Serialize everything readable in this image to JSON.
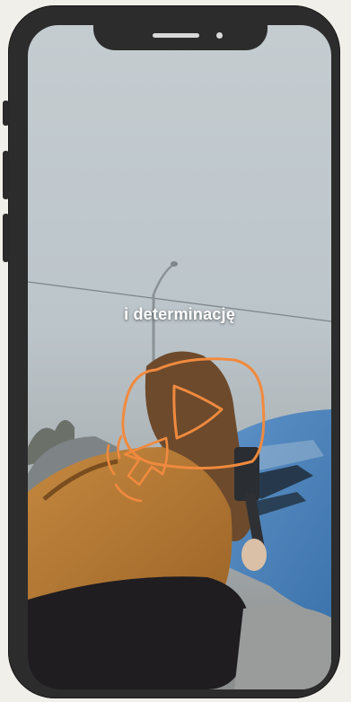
{
  "video": {
    "caption": "i determinację"
  },
  "colors": {
    "frame": "#2c2c2c",
    "accent_orange": "#f08a3e",
    "background": "#f1efea"
  },
  "icons": {
    "play": "play-icon",
    "cursor": "cursor-arrow-icon"
  }
}
